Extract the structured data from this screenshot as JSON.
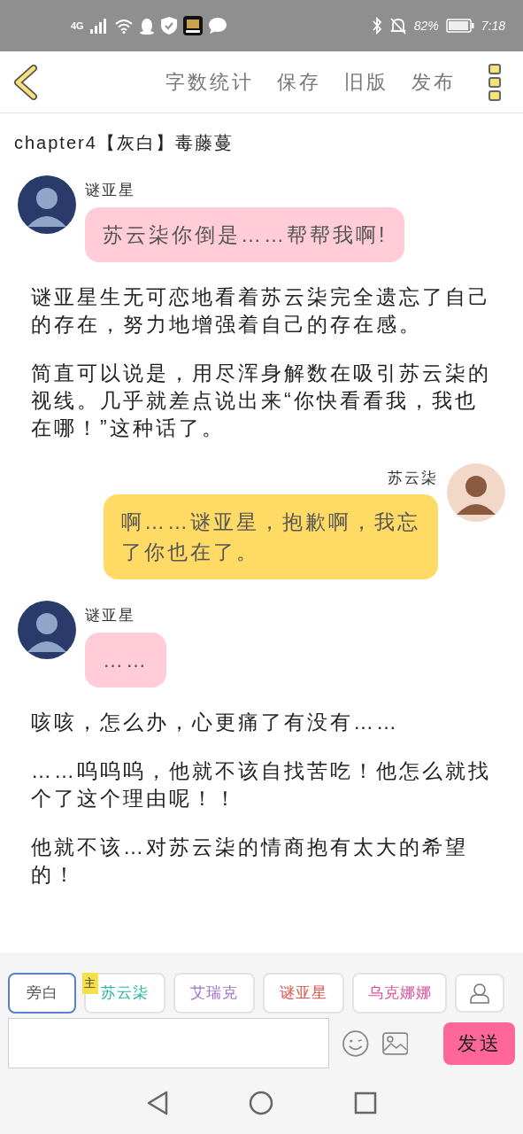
{
  "status_bar": {
    "network": "4G",
    "battery": "82%",
    "time": "7:18"
  },
  "toolbar": {
    "actions": [
      "字数统计",
      "保存",
      "旧版",
      "发布"
    ]
  },
  "chapter_title": "chapter4【灰白】毒藤蔓",
  "items": [
    {
      "kind": "incoming",
      "speaker": "谜亚星",
      "text": "苏云柒你倒是……帮帮我啊!",
      "color": "#ffccd8"
    },
    {
      "kind": "narration",
      "text": "谜亚星生无可恋地看着苏云柒完全遗忘了自己的存在，努力地增强着自己的存在感。"
    },
    {
      "kind": "narration",
      "text": "简直可以说是，用尽浑身解数在吸引苏云柒的视线。几乎就差点说出来“你快看看我，我也在哪！”这种话了。"
    },
    {
      "kind": "outgoing",
      "speaker": "苏云柒",
      "text": "啊……谜亚星，抱歉啊，我忘了你也在了。",
      "color": "#ffdb66"
    },
    {
      "kind": "incoming",
      "speaker": "谜亚星",
      "text": "……",
      "color": "#ffccd8"
    },
    {
      "kind": "narration",
      "text": "咳咳，怎么办，心更痛了有没有……"
    },
    {
      "kind": "narration",
      "text": "……呜呜呜，他就不该自找苦吃！他怎么就找个了这个理由呢！！"
    },
    {
      "kind": "narration",
      "text": "他就不该…对苏云柒的情商抱有太大的希望的！"
    }
  ],
  "roles": [
    {
      "label": "旁白",
      "selected": true,
      "color": "#555555"
    },
    {
      "label": "苏云柒",
      "selected": false,
      "color": "#2bb5a0",
      "badge": "主"
    },
    {
      "label": "艾瑞克",
      "selected": false,
      "color": "#a070d0"
    },
    {
      "label": "谜亚星",
      "selected": false,
      "color": "#e0504a"
    },
    {
      "label": "乌克娜娜",
      "selected": false,
      "color": "#e0509a"
    }
  ],
  "send_button": "发送"
}
